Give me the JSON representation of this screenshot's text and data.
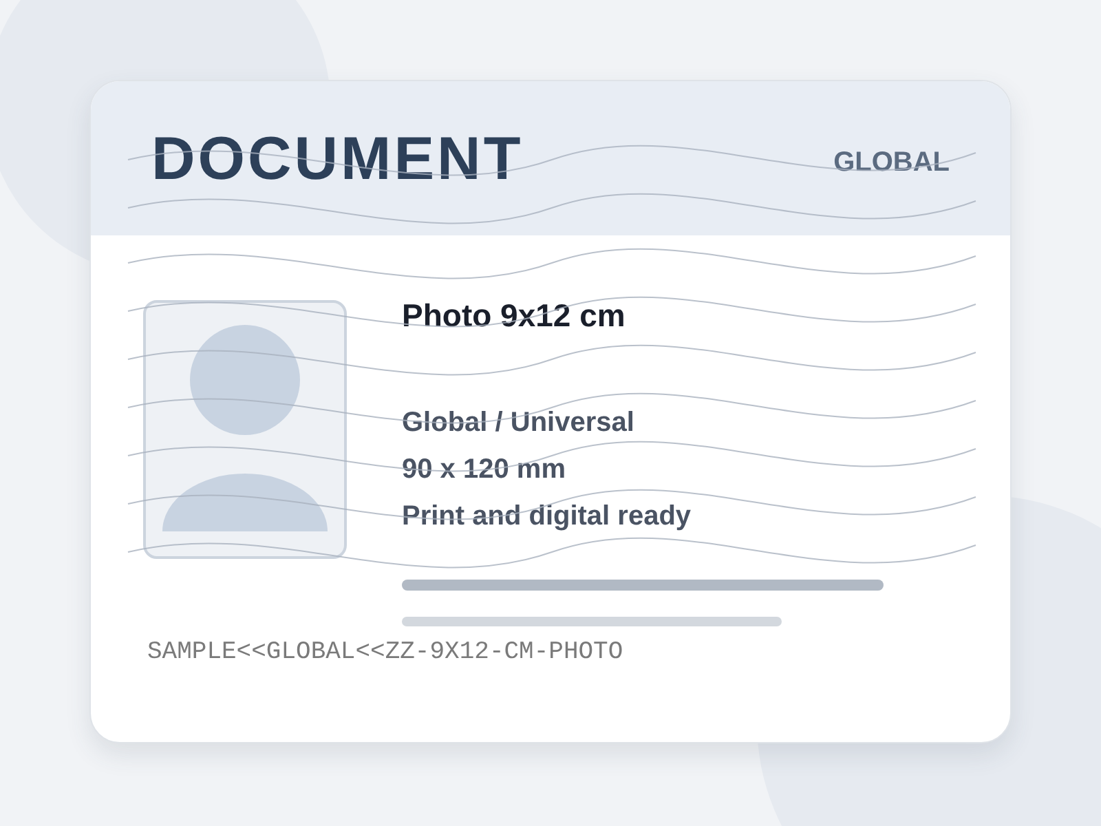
{
  "card": {
    "title": "DOCUMENT",
    "region": "GLOBAL",
    "heading": "Photo 9x12 cm",
    "details": [
      "Global / Universal",
      "90 x 120 mm",
      "Print and digital ready"
    ],
    "mrz": "SAMPLE<<GLOBAL<<ZZ-9X12-CM-PHOTO"
  }
}
